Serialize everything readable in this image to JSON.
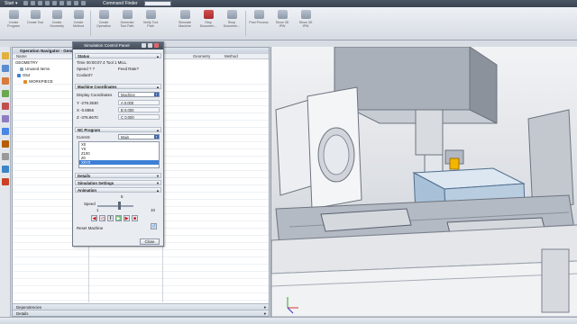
{
  "app": {
    "start_label": "Start",
    "command_finder_label": "Command Finder",
    "command_finder_placeholder": ""
  },
  "ribbon": {
    "buttons": [
      {
        "label": "Create Program"
      },
      {
        "label": "Create Tool"
      },
      {
        "label": "Create Geometry"
      },
      {
        "label": "Create Method"
      },
      {
        "label": "Create Operation"
      },
      {
        "label": "Generate Tool Path"
      },
      {
        "label": "Verify Tool Path"
      },
      {
        "label": "Simulate Machine"
      },
      {
        "label": "Stop Documen..."
      },
      {
        "label": "Shop Documen..."
      },
      {
        "label": "Post Process"
      },
      {
        "label": "Show 3D IPW"
      },
      {
        "label": "Show 3D IPW"
      }
    ]
  },
  "operation_navigator": {
    "title": "Operation Navigator - Geometry",
    "columns": [
      "Name",
      "Path",
      "Tool",
      "Geometry",
      "Method"
    ],
    "rows": [
      {
        "label": "GEOMETRY",
        "indent": 0
      },
      {
        "label": "Unused Items",
        "indent": 1
      },
      {
        "label": "G54",
        "indent": 1
      },
      {
        "label": "WORKPIECE",
        "indent": 2
      }
    ],
    "footer": [
      "Dependencies",
      "Details"
    ]
  },
  "sim_panel": {
    "title": "Simulation Control Panel",
    "status": {
      "header": "Status",
      "time_line": "Time 00:00:07.4 Tool 1  MILL",
      "speed_label": "Speed ? ?",
      "feed_label": "Feed Rate?",
      "coolant_label": "Coolant?"
    },
    "machine_coords": {
      "header": "Machine Coordinates",
      "display_label": "Display Coordinates",
      "display_value": "Machine",
      "axes": [
        {
          "name": "Y",
          "value": "-278.3530",
          "secondary": "A 0.000"
        },
        {
          "name": "X",
          "value": "-0.8856",
          "secondary": "B 0.000"
        },
        {
          "name": "Z",
          "value": "-376.9670",
          "secondary": "C 0.000"
        }
      ]
    },
    "nc_program": {
      "header": "NC Program",
      "current_label": "Current",
      "current_value": "Main",
      "lines": [
        "X0",
        "Y0",
        "Z100",
        "Z0",
        "X0Y0"
      ],
      "selected_index": 4
    },
    "collapsed_sections": [
      "Details",
      "Simulation Settings"
    ],
    "animation": {
      "header": "Animation",
      "speed_label": "Speed",
      "speed_value": "5",
      "speed_min": "1",
      "speed_max": "10",
      "speed_fraction": 0.6,
      "reset_label": "Reset Machine"
    },
    "close_label": "Close"
  },
  "status_bar": {
    "text": ""
  },
  "colors": {
    "accent_blue": "#3d7fd6",
    "tool_yellow": "#f4b400",
    "workpiece": "#b9cde0"
  }
}
